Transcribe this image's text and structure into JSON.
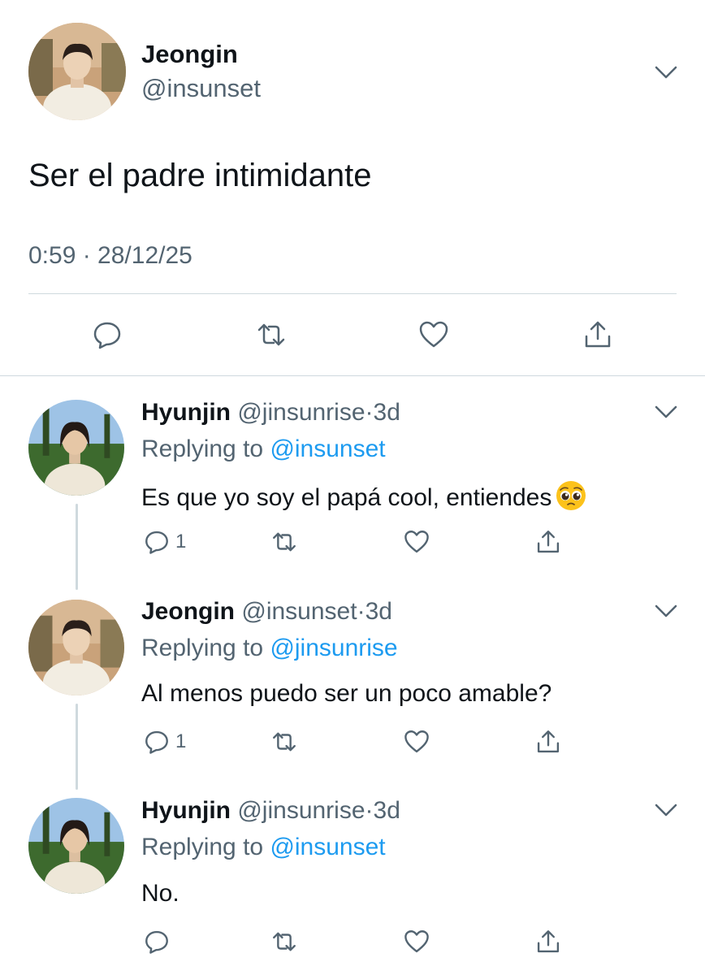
{
  "main_tweet": {
    "name": "Jeongin",
    "handle": "@insunset",
    "text": "Ser el padre intimidante",
    "timestamp": "0:59 · 28/12/25",
    "avatar_icon": "jeongin-avatar"
  },
  "replies": [
    {
      "name": "Hyunjin",
      "handle": "@jinsunrise",
      "dot": "·",
      "age": "3d",
      "replying_prefix": "Replying to ",
      "replying_to": "@insunset",
      "text": "Es que yo soy el papá cool, entiendes",
      "emoji": "pleading-face-emoji",
      "reply_count": "1",
      "avatar_icon": "hyunjin-avatar"
    },
    {
      "name": "Jeongin",
      "handle": "@insunset",
      "dot": "·",
      "age": "3d",
      "replying_prefix": "Replying to ",
      "replying_to": "@jinsunrise",
      "text": "Al menos puedo ser un poco amable?",
      "reply_count": "1",
      "avatar_icon": "jeongin-avatar"
    },
    {
      "name": "Hyunjin",
      "handle": "@jinsunrise",
      "dot": "·",
      "age": "3d",
      "replying_prefix": "Replying to ",
      "replying_to": "@insunset",
      "text": "No.",
      "reply_count": "",
      "avatar_icon": "hyunjin-avatar"
    }
  ],
  "colors": {
    "text_primary": "#0f1419",
    "text_secondary": "#536471",
    "link": "#1d9bf0",
    "divider": "#cfd9de"
  }
}
